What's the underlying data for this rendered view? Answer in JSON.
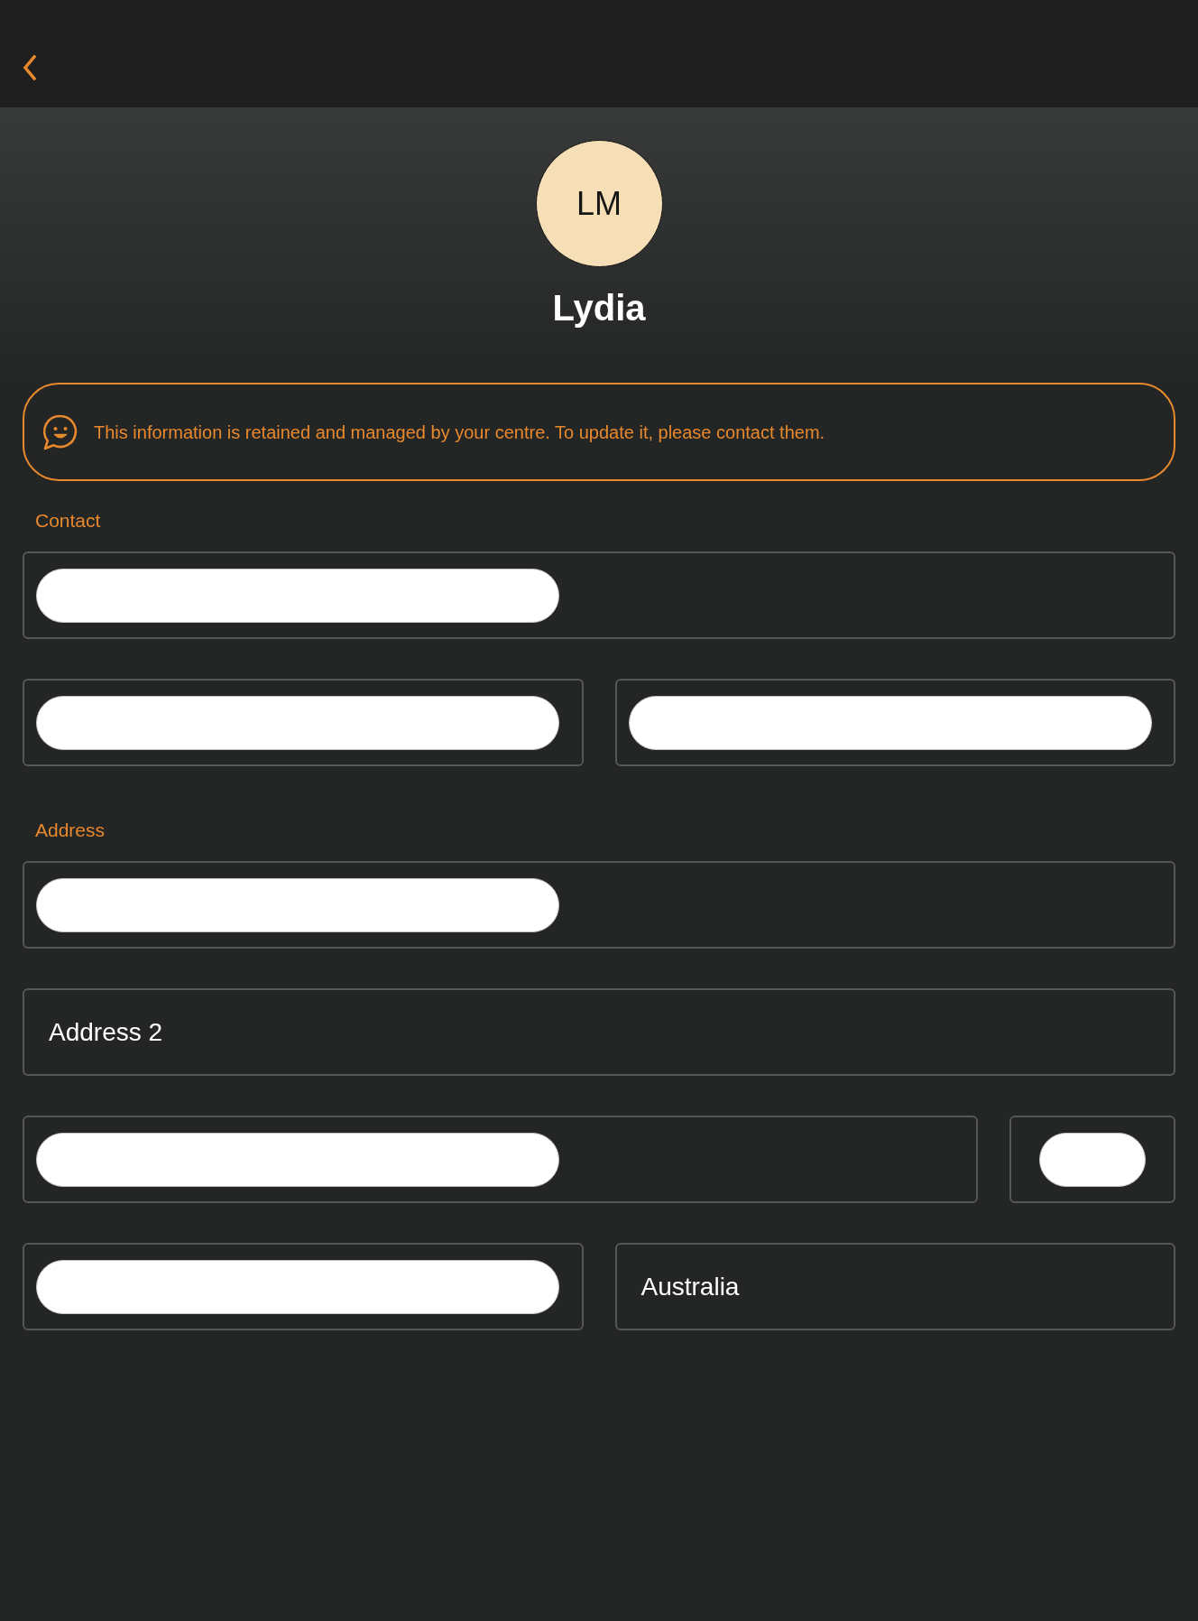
{
  "profile": {
    "initials": "LM",
    "name": "Lydia"
  },
  "notice": {
    "text": "This information is retained and managed by your centre. To update it, please contact them."
  },
  "sections": [
    {
      "title": "Contact",
      "rows": [
        [
          {
            "kind": "redacted",
            "narrow": false
          }
        ],
        [
          {
            "kind": "redacted",
            "narrow": false
          },
          {
            "kind": "redacted",
            "narrow": false
          }
        ]
      ]
    },
    {
      "title": "Address",
      "rows": [
        [
          {
            "kind": "redacted",
            "narrow": false
          }
        ],
        [
          {
            "kind": "input",
            "placeholder": "Address 2",
            "narrow": false
          }
        ],
        [
          {
            "kind": "redacted",
            "narrow": false
          },
          {
            "kind": "redacted",
            "narrow": true
          }
        ],
        [
          {
            "kind": "redacted",
            "narrow": false
          },
          {
            "kind": "input",
            "value": "Australia",
            "narrow": false
          }
        ]
      ]
    }
  ]
}
